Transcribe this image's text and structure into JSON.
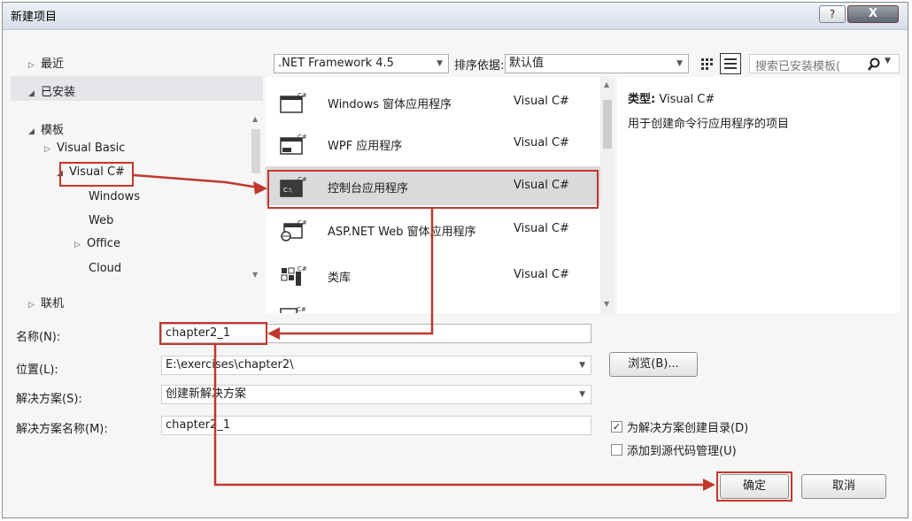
{
  "window": {
    "title": "新建项目",
    "help_label": "?",
    "close_label": "X"
  },
  "tree": {
    "recent": "最近",
    "installed": "已安装",
    "templates": "模板",
    "visual_basic": "Visual Basic",
    "visual_csharp": "Visual C#",
    "windows": "Windows",
    "web": "Web",
    "office": "Office",
    "cloud": "Cloud",
    "online": "联机"
  },
  "toolbar": {
    "framework": ".NET Framework 4.5",
    "sort_label": "排序依据:",
    "sort_value": "默认值",
    "search_placeholder": "搜索已安装模板("
  },
  "templates": [
    {
      "name": "Windows 窗体应用程序",
      "lang": "Visual C#",
      "icon": "windows-forms-icon"
    },
    {
      "name": "WPF 应用程序",
      "lang": "Visual C#",
      "icon": "wpf-app-icon"
    },
    {
      "name": "控制台应用程序",
      "lang": "Visual C#",
      "icon": "console-app-icon"
    },
    {
      "name": "ASP.NET Web 窗体应用程序",
      "lang": "Visual C#",
      "icon": "aspnet-web-icon"
    },
    {
      "name": "类库",
      "lang": "Visual C#",
      "icon": "class-library-icon"
    }
  ],
  "detail": {
    "type_label": "类型:",
    "type_value": "Visual C#",
    "description": "用于创建命令行应用程序的项目"
  },
  "form": {
    "name_label": "名称(N):",
    "name_value": "chapter2_1",
    "location_label": "位置(L):",
    "location_value": "E:\\exercises\\chapter2\\",
    "solution_label": "解决方案(S):",
    "solution_value": "创建新解决方案",
    "solution_name_label": "解决方案名称(M):",
    "solution_name_value": "chapter2_1",
    "browse_label": "浏览(B)...",
    "create_dir_label": "为解决方案创建目录(D)",
    "create_dir_checked": true,
    "source_control_label": "添加到源代码管理(U)",
    "source_control_checked": false
  },
  "buttons": {
    "ok": "确定",
    "cancel": "取消"
  },
  "colors": {
    "highlight": "#c0392b",
    "selected_row": "#dadada"
  }
}
